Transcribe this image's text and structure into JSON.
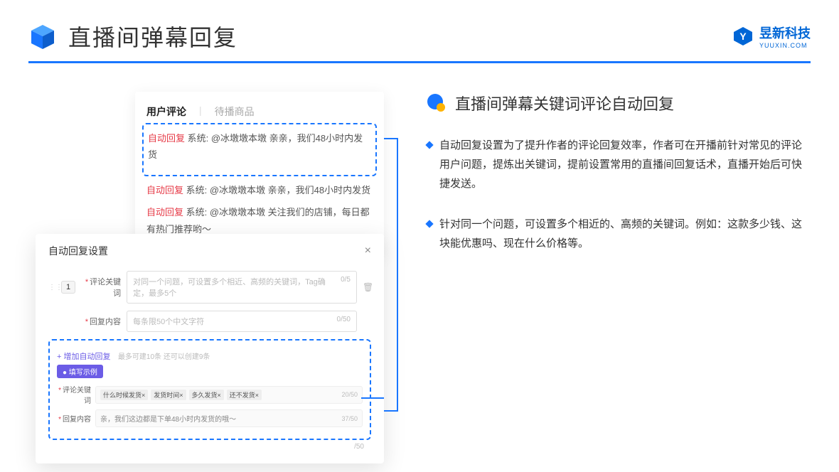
{
  "header": {
    "title": "直播间弹幕回复",
    "brand": "昱新科技",
    "brand_sub": "YUUXIN.COM"
  },
  "comment_panel": {
    "tab_active": "用户评论",
    "tab_inactive": "待播商品",
    "items": [
      {
        "tag": "自动回复",
        "text": "系统: @冰墩墩本墩 亲亲，我们48小时内发货"
      },
      {
        "tag": "自动回复",
        "text": "系统: @冰墩墩本墩 亲亲，我们48小时内发货"
      },
      {
        "tag": "自动回复",
        "text": "系统: @冰墩墩本墩 关注我们的店铺，每日都有热门推荐哟～"
      }
    ]
  },
  "settings": {
    "title": "自动回复设置",
    "number": "1",
    "keyword_label": "评论关键词",
    "keyword_placeholder": "对同一个问题，可设置多个相近、高频的关键词，Tag确定，最多5个",
    "keyword_counter": "0/5",
    "reply_label": "回复内容",
    "reply_placeholder": "每条限50个中文字符",
    "reply_counter": "0/50",
    "add_link": "+ 增加自动回复",
    "add_hint": "最多可建10条 还可以创建9条",
    "example_badge": "● 填写示例",
    "ex_keyword_label": "评论关键词",
    "ex_tags": [
      "什么时候发货×",
      "发货时间×",
      "多久发货×",
      "还不发货×"
    ],
    "ex_keyword_counter": "20/50",
    "ex_reply_label": "回复内容",
    "ex_reply_text": "亲，我们这边都是下单48小时内发货的哦～",
    "ex_reply_counter": "37/50",
    "trailing_counter": "/50"
  },
  "right": {
    "section_title": "直播间弹幕关键词评论自动回复",
    "bullets": [
      "自动回复设置为了提升作者的评论回复效率，作者可在开播前针对常见的评论用户问题，提炼出关键词，提前设置常用的直播间回复话术，直播开始后可快捷发送。",
      "针对同一个问题，可设置多个相近的、高频的关键词。例如：这款多少钱、这块能优惠吗、现在什么价格等。"
    ]
  }
}
